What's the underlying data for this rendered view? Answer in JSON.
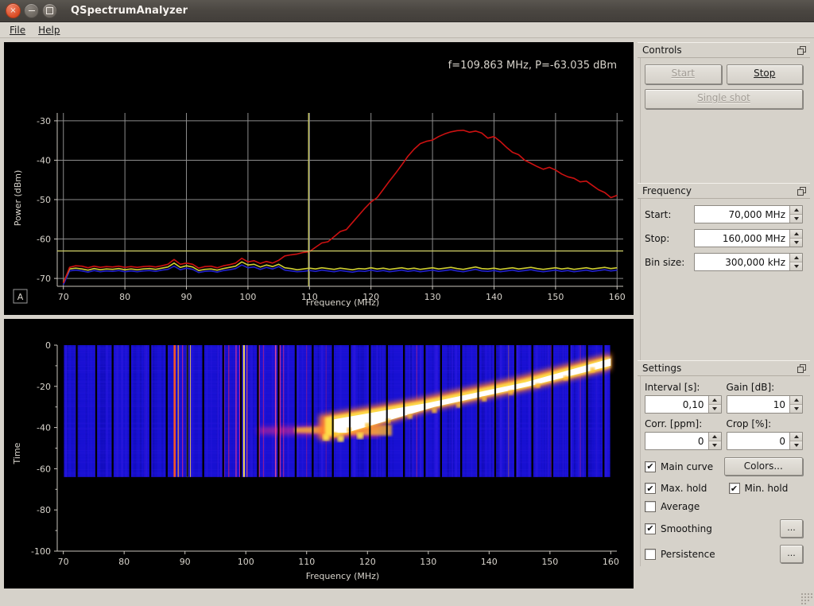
{
  "window": {
    "title": "QSpectrumAnalyzer",
    "buttons": {
      "close": "×",
      "minimize": "minimize",
      "maximize": "maximize"
    }
  },
  "menubar": [
    {
      "label": "File",
      "mnemonic": "F"
    },
    {
      "label": "Help",
      "mnemonic": "H"
    }
  ],
  "readout": "f=109.863 MHz, P=-63.035 dBm",
  "autoscale_badge": "A",
  "panels": {
    "controls": {
      "title": "Controls",
      "start_label": "Start",
      "stop_label": "Stop",
      "single_shot_label": "Single shot",
      "start_enabled": false,
      "stop_enabled": true,
      "single_shot_enabled": false
    },
    "frequency": {
      "title": "Frequency",
      "fields": [
        {
          "label": "Start:",
          "value": "70,000 MHz"
        },
        {
          "label": "Stop:",
          "value": "160,000 MHz"
        },
        {
          "label": "Bin size:",
          "value": "300,000 kHz"
        }
      ]
    },
    "settings": {
      "title": "Settings",
      "interval_label": "Interval [s]:",
      "interval_value": "0,10",
      "gain_label": "Gain [dB]:",
      "gain_value": "10",
      "corr_label": "Corr. [ppm]:",
      "corr_value": "0",
      "crop_label": "Crop [%]:",
      "crop_value": "0",
      "colors_label": "Colors...",
      "dots_label": "...",
      "checkboxes": [
        {
          "label": "Main curve",
          "checked": true
        },
        {
          "label": "Max. hold",
          "checked": true
        },
        {
          "label": "Min. hold",
          "checked": true
        },
        {
          "label": "Average",
          "checked": false
        },
        {
          "label": "Smoothing",
          "checked": true
        },
        {
          "label": "Persistence",
          "checked": false
        }
      ],
      "checkmark": "✔"
    }
  },
  "colors": {
    "plot_background": "#000000",
    "grid": "#9a9a9a",
    "axis_text": "#d8d4cc",
    "max_hold_curve": "#cc1111",
    "main_curve": "#cccc33",
    "min_hold_curve": "#2222cc",
    "crosshair": "#c8c864",
    "panel_background": "#d6d2ca",
    "titlebar": "#4a4641"
  },
  "chart_data": [
    {
      "type": "line",
      "title": "f=109.863 MHz, P=-63.035 dBm",
      "xlabel": "Frequency (MHz)",
      "ylabel": "Power (dBm)",
      "xlim": [
        69,
        161
      ],
      "ylim": [
        -72,
        -28
      ],
      "xticks": [
        70,
        80,
        90,
        100,
        110,
        120,
        130,
        140,
        150,
        160
      ],
      "yticks": [
        -30,
        -40,
        -50,
        -60,
        -70
      ],
      "grid": true,
      "legend": "none",
      "marker": {
        "x": 109.863,
        "y": -63.035,
        "label": "f=109.863 MHz, P=-63.035 dBm"
      },
      "x": [
        70,
        71,
        72,
        73,
        74,
        75,
        76,
        77,
        78,
        79,
        80,
        81,
        82,
        83,
        84,
        85,
        86,
        87,
        88,
        89,
        90,
        91,
        92,
        93,
        94,
        95,
        96,
        97,
        98,
        99,
        100,
        101,
        102,
        103,
        104,
        105,
        106,
        107,
        108,
        109,
        110,
        111,
        112,
        113,
        114,
        115,
        116,
        117,
        118,
        119,
        120,
        121,
        122,
        123,
        124,
        125,
        126,
        127,
        128,
        129,
        130,
        131,
        132,
        133,
        134,
        135,
        136,
        137,
        138,
        139,
        140,
        141,
        142,
        143,
        144,
        145,
        146,
        147,
        148,
        149,
        150,
        151,
        152,
        153,
        154,
        155,
        156,
        157,
        158,
        159,
        160
      ],
      "series": [
        {
          "name": "Max. hold",
          "color": "#cc1111",
          "values": [
            -71.2,
            -67.2,
            -66.8,
            -66.9,
            -67.3,
            -66.9,
            -67.2,
            -67.0,
            -67.1,
            -66.9,
            -67.2,
            -67.0,
            -67.2,
            -67.0,
            -66.9,
            -67.1,
            -66.8,
            -66.4,
            -65.2,
            -66.4,
            -66.1,
            -66.4,
            -67.4,
            -67.0,
            -66.9,
            -67.3,
            -66.8,
            -66.5,
            -66.1,
            -64.9,
            -65.8,
            -65.5,
            -66.2,
            -65.7,
            -66.1,
            -65.4,
            -64.3,
            -64.0,
            -63.8,
            -63.4,
            -63.2,
            -62.1,
            -61.0,
            -60.7,
            -59.4,
            -58.1,
            -57.6,
            -55.8,
            -54.0,
            -52.2,
            -50.6,
            -49.5,
            -47.4,
            -45.3,
            -43.3,
            -41.2,
            -39.0,
            -37.2,
            -35.8,
            -35.2,
            -34.9,
            -34.0,
            -33.3,
            -32.8,
            -32.5,
            -32.4,
            -32.9,
            -32.6,
            -33.1,
            -34.4,
            -34.0,
            -35.2,
            -36.7,
            -38.0,
            -38.6,
            -40.0,
            -40.8,
            -41.6,
            -42.3,
            -41.8,
            -42.5,
            -43.5,
            -44.2,
            -44.6,
            -45.5,
            -45.3,
            -46.4,
            -47.5,
            -48.2,
            -49.5,
            -48.9
          ]
        },
        {
          "name": "Main curve",
          "color": "#cccc33",
          "values": [
            -71.0,
            -67.6,
            -67.4,
            -67.6,
            -67.9,
            -67.5,
            -67.8,
            -67.6,
            -67.7,
            -67.5,
            -67.8,
            -67.6,
            -67.8,
            -67.6,
            -67.5,
            -67.7,
            -67.4,
            -67.1,
            -66.1,
            -67.2,
            -66.8,
            -67.1,
            -68.0,
            -67.7,
            -67.6,
            -67.9,
            -67.5,
            -67.2,
            -66.9,
            -65.8,
            -66.6,
            -66.4,
            -67.1,
            -66.6,
            -67.0,
            -66.4,
            -67.3,
            -67.5,
            -67.8,
            -67.6,
            -67.4,
            -67.6,
            -67.3,
            -67.5,
            -67.7,
            -67.4,
            -67.6,
            -67.8,
            -67.5,
            -67.6,
            -67.3,
            -67.6,
            -67.4,
            -67.7,
            -67.5,
            -67.3,
            -67.6,
            -67.4,
            -67.7,
            -67.5,
            -67.3,
            -67.6,
            -67.4,
            -67.2,
            -67.5,
            -67.7,
            -67.4,
            -67.1,
            -67.5,
            -67.6,
            -67.4,
            -67.7,
            -67.5,
            -67.3,
            -67.6,
            -67.4,
            -67.2,
            -67.5,
            -67.7,
            -67.5,
            -67.3,
            -67.6,
            -67.4,
            -67.7,
            -67.5,
            -67.3,
            -67.6,
            -67.4,
            -67.2,
            -67.5,
            -67.3
          ]
        },
        {
          "name": "Min. hold",
          "color": "#2222cc",
          "values": [
            -71.6,
            -68.1,
            -67.9,
            -68.1,
            -68.4,
            -68.0,
            -68.3,
            -68.1,
            -68.2,
            -68.0,
            -68.3,
            -68.1,
            -68.3,
            -68.1,
            -68.0,
            -68.2,
            -67.9,
            -67.7,
            -66.9,
            -67.8,
            -67.4,
            -67.7,
            -68.5,
            -68.2,
            -68.1,
            -68.4,
            -68.0,
            -67.8,
            -67.5,
            -66.6,
            -67.3,
            -67.1,
            -67.7,
            -67.2,
            -67.6,
            -67.0,
            -67.9,
            -68.1,
            -68.3,
            -68.2,
            -68.0,
            -68.2,
            -67.9,
            -68.1,
            -68.3,
            -68.0,
            -68.2,
            -68.4,
            -68.1,
            -68.2,
            -67.9,
            -68.2,
            -68.0,
            -68.3,
            -68.1,
            -67.9,
            -68.2,
            -68.0,
            -68.3,
            -68.1,
            -67.9,
            -68.2,
            -68.0,
            -67.8,
            -68.1,
            -68.3,
            -68.0,
            -67.7,
            -68.1,
            -68.2,
            -68.0,
            -68.3,
            -68.1,
            -67.9,
            -68.2,
            -68.0,
            -67.8,
            -68.1,
            -68.3,
            -68.1,
            -67.9,
            -68.2,
            -68.0,
            -68.3,
            -68.1,
            -67.9,
            -68.2,
            -68.0,
            -67.8,
            -68.1,
            -67.9
          ]
        }
      ]
    },
    {
      "type": "heatmap",
      "title": "",
      "xlabel": "Frequency (MHz)",
      "ylabel": "Time",
      "xlim": [
        69,
        161
      ],
      "ylim": [
        -100,
        0
      ],
      "xticks": [
        70,
        80,
        90,
        100,
        110,
        120,
        130,
        140,
        150,
        160
      ],
      "yticks": [
        0,
        -20,
        -40,
        -60,
        -80,
        -100
      ],
      "grid": false,
      "colormap": "blue-magenta-yellow-white",
      "data_time_extent": [
        0,
        -64
      ],
      "description": "Waterfall: blue noise floor with vertical narrowband streaks near 88-100 MHz and a broad diagonal white trace sweeping from ~112 MHz at time -42 up to ~160 MHz at time -6."
    }
  ]
}
